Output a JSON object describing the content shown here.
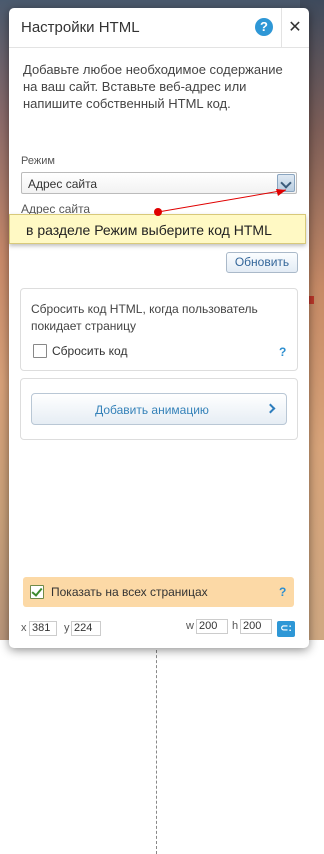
{
  "panel": {
    "title": "Настройки HTML",
    "help_icon": "?",
    "close_icon": "✕",
    "intro": "Добавьте любое необходимое содержание на ваш сайт. Вставьте веб-адрес или напишите собственный HTML код."
  },
  "mode": {
    "label": "Режим",
    "value": "Адрес сайта",
    "url_label": "Адрес сайта"
  },
  "tooltip": {
    "text": "в разделе Режим выберите код HTML"
  },
  "update_button": "Обновить",
  "reset": {
    "description": "Сбросить код HTML, когда пользователь покидает страницу",
    "checkbox_label": "Сбросить код",
    "checked": false,
    "help": "?"
  },
  "animation": {
    "button_label": "Добавить анимацию"
  },
  "show_all": {
    "label": "Показать на всех страницах",
    "checked": true,
    "help": "?"
  },
  "position": {
    "x_label": "x",
    "x_value": "381",
    "y_label": "y",
    "y_value": "224",
    "w_label": "w",
    "w_value": "200",
    "h_label": "h",
    "h_value": "200"
  },
  "colors": {
    "accent": "#2e97d6",
    "tooltip_bg": "#fff9c4",
    "show_all_bg": "#fcd9a6",
    "annotation": "#e00000"
  }
}
